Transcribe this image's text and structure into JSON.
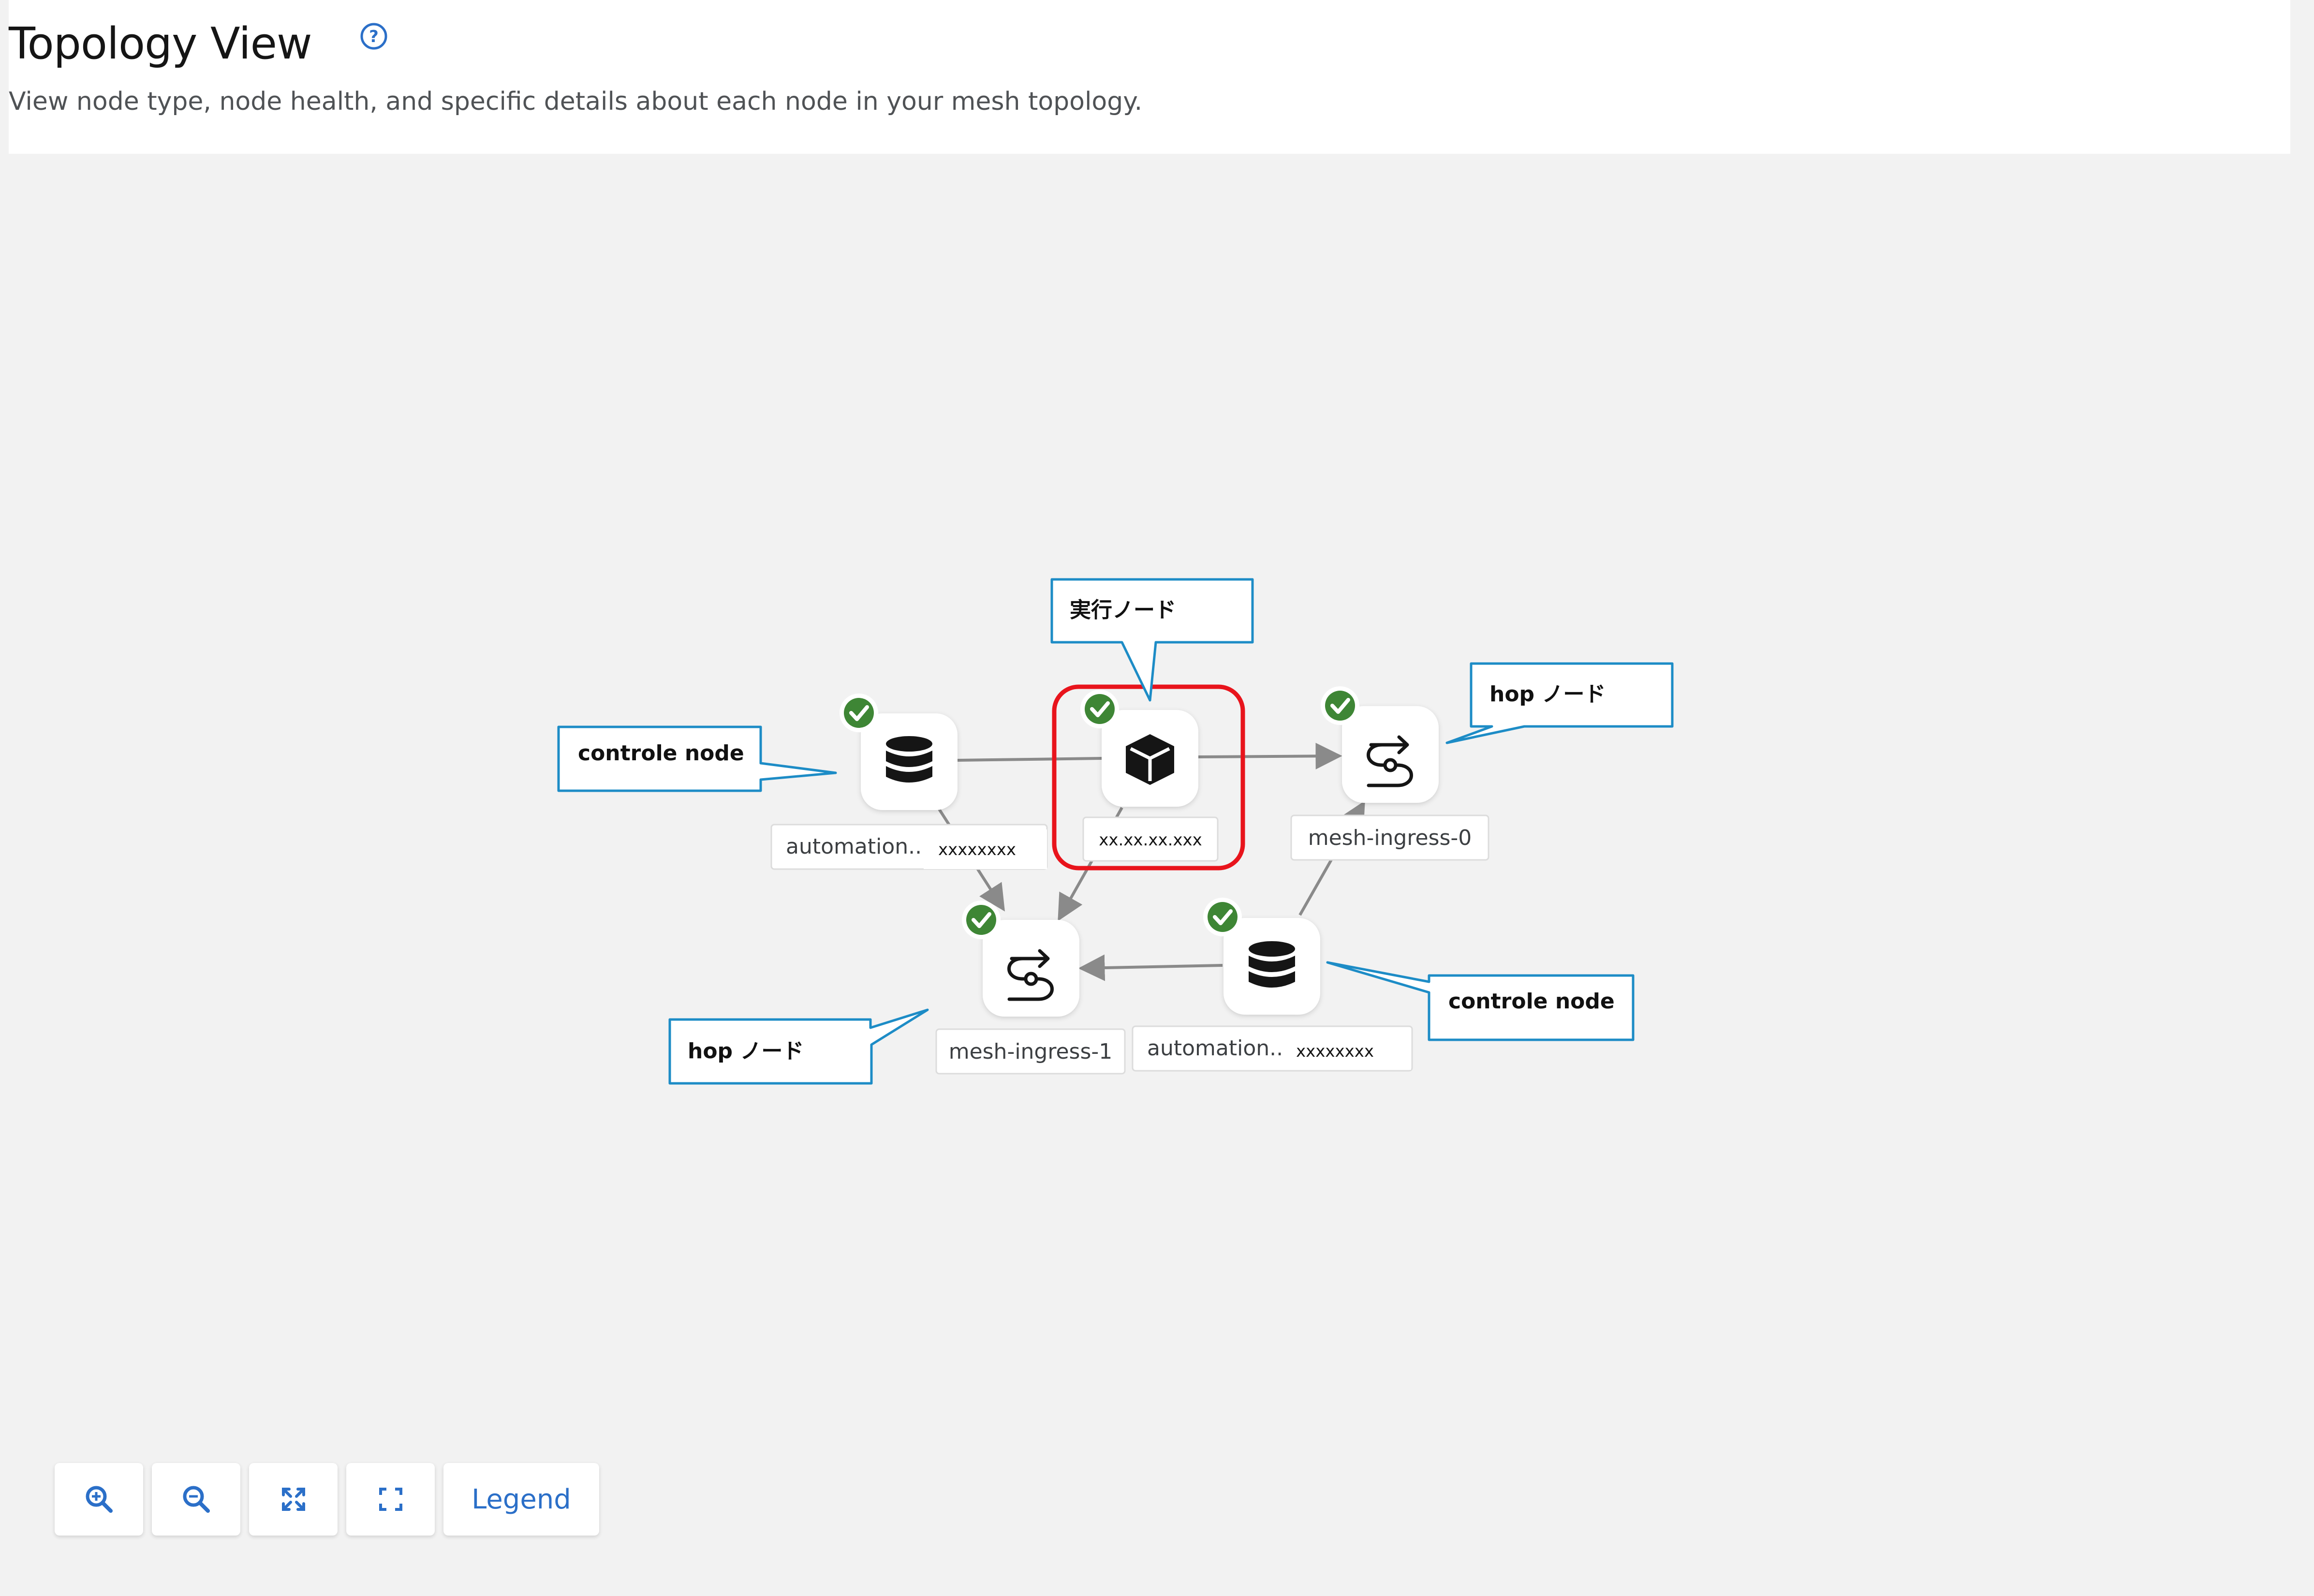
{
  "header": {
    "title": "Topology View",
    "description": "View node type, node health, and specific details about each node in your mesh topology."
  },
  "nodes": [
    {
      "id": "control-1",
      "type": "control",
      "label": "automation...",
      "sublabel": "xxxxxxxx",
      "status": "healthy"
    },
    {
      "id": "execution",
      "type": "execution",
      "label": "xx.xx.xx.xxx",
      "status": "healthy"
    },
    {
      "id": "hop-0",
      "type": "hop",
      "label": "mesh-ingress-0",
      "status": "healthy"
    },
    {
      "id": "hop-1",
      "type": "hop",
      "label": "mesh-ingress-1",
      "status": "healthy"
    },
    {
      "id": "control-2",
      "type": "control",
      "label": "automation...",
      "sublabel": "xxxxxxxx",
      "status": "healthy"
    }
  ],
  "callouts": {
    "execution": "実行ノード",
    "hop_top": "hop ノード",
    "control_left": "controle node",
    "control_right": "controle node",
    "hop_bottom": "hop ノード"
  },
  "controls": {
    "zoom_in": "zoom-in",
    "zoom_out": "zoom-out",
    "fit": "fit-to-screen",
    "reset": "reset-view",
    "legend_label": "Legend"
  },
  "colors": {
    "status_ok": "#3e8635",
    "highlight": "#e8141c",
    "callout_border": "#1d8cc6",
    "edge": "#8a8a8a",
    "link": "#2b6fc8"
  }
}
